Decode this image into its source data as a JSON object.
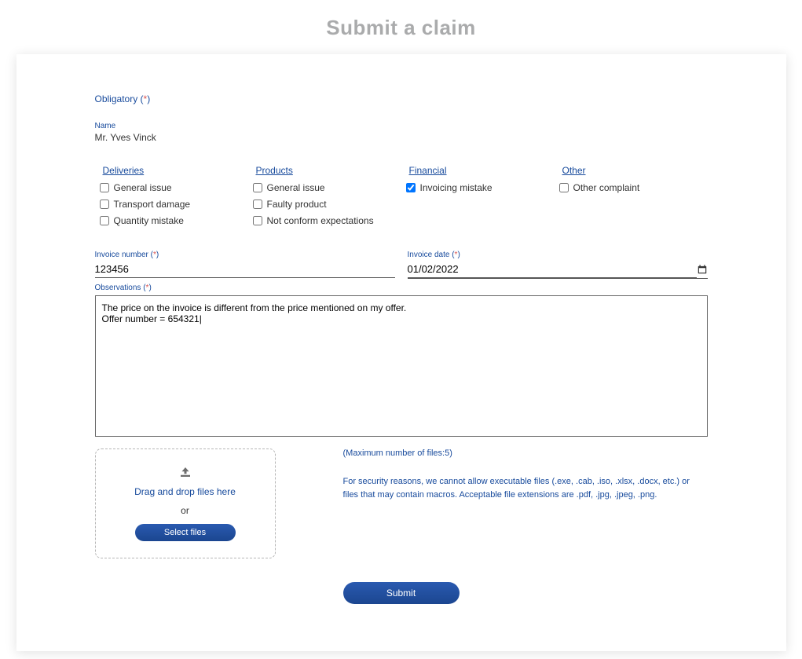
{
  "title": "Submit a claim",
  "obligatory_label": "Obligatory",
  "name_label": "Name",
  "name_value": "Mr. Yves Vinck",
  "categories": {
    "deliveries": {
      "header": "Deliveries",
      "items": [
        "General issue",
        "Transport damage",
        "Quantity mistake"
      ]
    },
    "products": {
      "header": "Products",
      "items": [
        "General issue",
        "Faulty product",
        "Not conform expectations"
      ]
    },
    "financial": {
      "header": "Financial",
      "items": [
        "Invoicing mistake"
      ],
      "checked": [
        true
      ]
    },
    "other": {
      "header": "Other",
      "items": [
        "Other complaint"
      ]
    }
  },
  "invoice_number_label": "Invoice number",
  "invoice_number_value": "123456",
  "invoice_date_label": "Invoice date",
  "invoice_date_value": "01/02/2022",
  "observations_label": "Observations",
  "observations_value": "The price on the invoice is different from the price mentioned on my offer.\nOffer number = 654321|",
  "dropzone": {
    "drag_label": "Drag and drop files here",
    "or_label": "or",
    "select_label": "Select files"
  },
  "max_files_label": "(Maximum number of files:5)",
  "security_label": "For security reasons, we cannot allow executable files (.exe, .cab, .iso, .xlsx, .docx, etc.) or files that may contain macros. Acceptable file extensions are .pdf, .jpg, .jpeg, .png.",
  "submit_label": "Submit"
}
